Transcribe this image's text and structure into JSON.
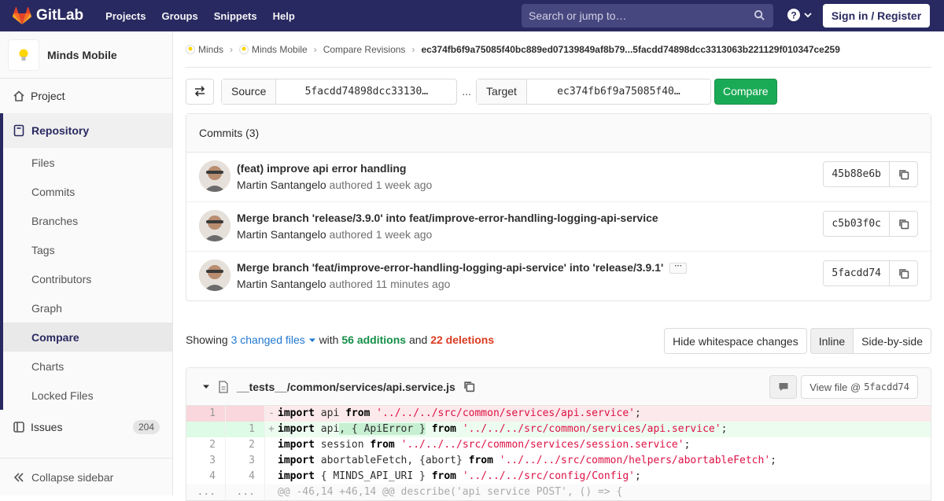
{
  "topnav": {
    "brand": "GitLab",
    "links": [
      "Projects",
      "Groups",
      "Snippets",
      "Help"
    ],
    "search_placeholder": "Search or jump to…",
    "signin": "Sign in / Register"
  },
  "sidebar": {
    "project_name": "Minds Mobile",
    "project": "Project",
    "repository": "Repository",
    "repo_items": [
      "Files",
      "Commits",
      "Branches",
      "Tags",
      "Contributors",
      "Graph",
      "Compare",
      "Charts",
      "Locked Files"
    ],
    "active_item": "Compare",
    "issues": "Issues",
    "issues_count": "204",
    "collapse": "Collapse sidebar"
  },
  "breadcrumb": {
    "items": [
      "Minds",
      "Minds Mobile",
      "Compare Revisions"
    ],
    "current": "ec374fb6f9a75085f40bc889ed07139849af8b79...5facdd74898dcc3313063b221129f010347ce259"
  },
  "compare": {
    "source_label": "Source",
    "source_value": "5facdd74898dcc33130…",
    "dots": "...",
    "target_label": "Target",
    "target_value": "ec374fb6f9a75085f40…",
    "button": "Compare"
  },
  "commits": {
    "header": "Commits (3)",
    "authored": "authored",
    "items": [
      {
        "title": "(feat) improve api error handling",
        "author": "Martin Santangelo",
        "time": "1 week ago",
        "sha": "45b88e6b"
      },
      {
        "title": "Merge branch 'release/3.9.0' into feat/improve-error-handling-logging-api-service",
        "author": "Martin Santangelo",
        "time": "1 week ago",
        "sha": "c5b03f0c"
      },
      {
        "title": "Merge branch 'feat/improve-error-handling-logging-api-service' into 'release/3.9.1'",
        "author": "Martin Santangelo",
        "time": "11 minutes ago",
        "sha": "5facdd74"
      }
    ]
  },
  "summary": {
    "showing": "Showing",
    "changed": "3 changed files",
    "with": "with",
    "additions": "56 additions",
    "and": "and",
    "deletions": "22 deletions"
  },
  "diff_options": {
    "hide_whitespace": "Hide whitespace changes",
    "inline": "Inline",
    "side_by_side": "Side-by-side"
  },
  "file": {
    "path": "__tests__/common/services/api.service.js",
    "view_file": "View file @",
    "view_sha": "5facdd74"
  },
  "colors": {
    "nav": "#292961",
    "compare_button": "#1aaa55",
    "additions": "#168f48",
    "deletions": "#db3b21",
    "link": "#1f78d1"
  }
}
